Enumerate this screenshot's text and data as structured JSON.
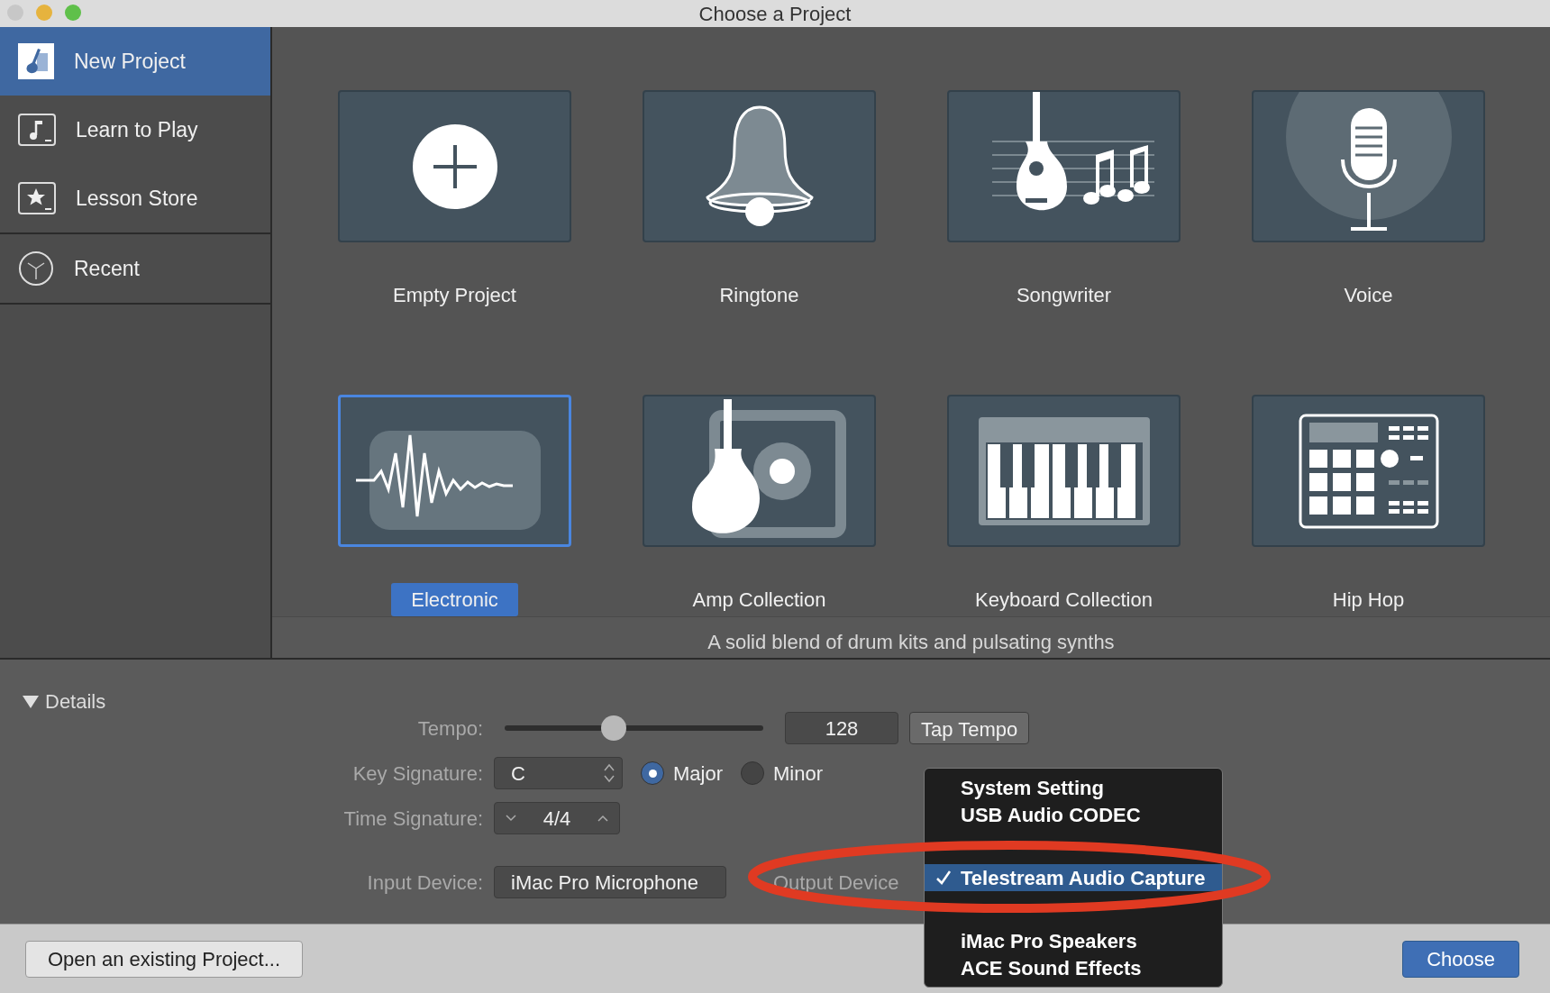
{
  "window": {
    "title": "Choose a Project"
  },
  "sidebar": {
    "sections": [
      {
        "items": [
          {
            "label": "New Project",
            "selected": true
          },
          {
            "label": "Learn to Play",
            "selected": false
          },
          {
            "label": "Lesson Store",
            "selected": false
          }
        ]
      },
      {
        "items": [
          {
            "label": "Recent",
            "selected": false
          }
        ]
      }
    ]
  },
  "templates": [
    {
      "label": "Empty Project",
      "selected": false
    },
    {
      "label": "Ringtone",
      "selected": false
    },
    {
      "label": "Songwriter",
      "selected": false
    },
    {
      "label": "Voice",
      "selected": false
    },
    {
      "label": "Electronic",
      "selected": true
    },
    {
      "label": "Amp Collection",
      "selected": false
    },
    {
      "label": "Keyboard Collection",
      "selected": false
    },
    {
      "label": "Hip Hop",
      "selected": false
    }
  ],
  "description": "A solid blend of drum kits and pulsating synths",
  "details": {
    "title": "Details",
    "expanded": true,
    "tempo": {
      "label": "Tempo:",
      "level": 0.42,
      "value": "128",
      "tap_button": "Tap Tempo"
    },
    "key_signature": {
      "label": "Key Signature:",
      "value": "C",
      "modes": [
        {
          "label": "Major",
          "selected": true
        },
        {
          "label": "Minor",
          "selected": false
        }
      ]
    },
    "time_signature": {
      "label": "Time Signature:",
      "value": "4/4"
    },
    "input_device": {
      "label": "Input Device:",
      "value": "iMac Pro Microphone"
    },
    "output_device": {
      "label": "Output Device",
      "menu": [
        {
          "label": "System Setting",
          "selected": false
        },
        {
          "label": "USB Audio CODEC",
          "selected": false
        },
        {
          "label": "Telestream Audio Capture",
          "selected": true
        },
        {
          "label": "iMac Pro Speakers",
          "selected": false
        },
        {
          "label": "ACE Sound Effects",
          "selected": false
        }
      ]
    }
  },
  "footer": {
    "open_button": "Open an existing Project...",
    "choose_button": "Choose"
  }
}
